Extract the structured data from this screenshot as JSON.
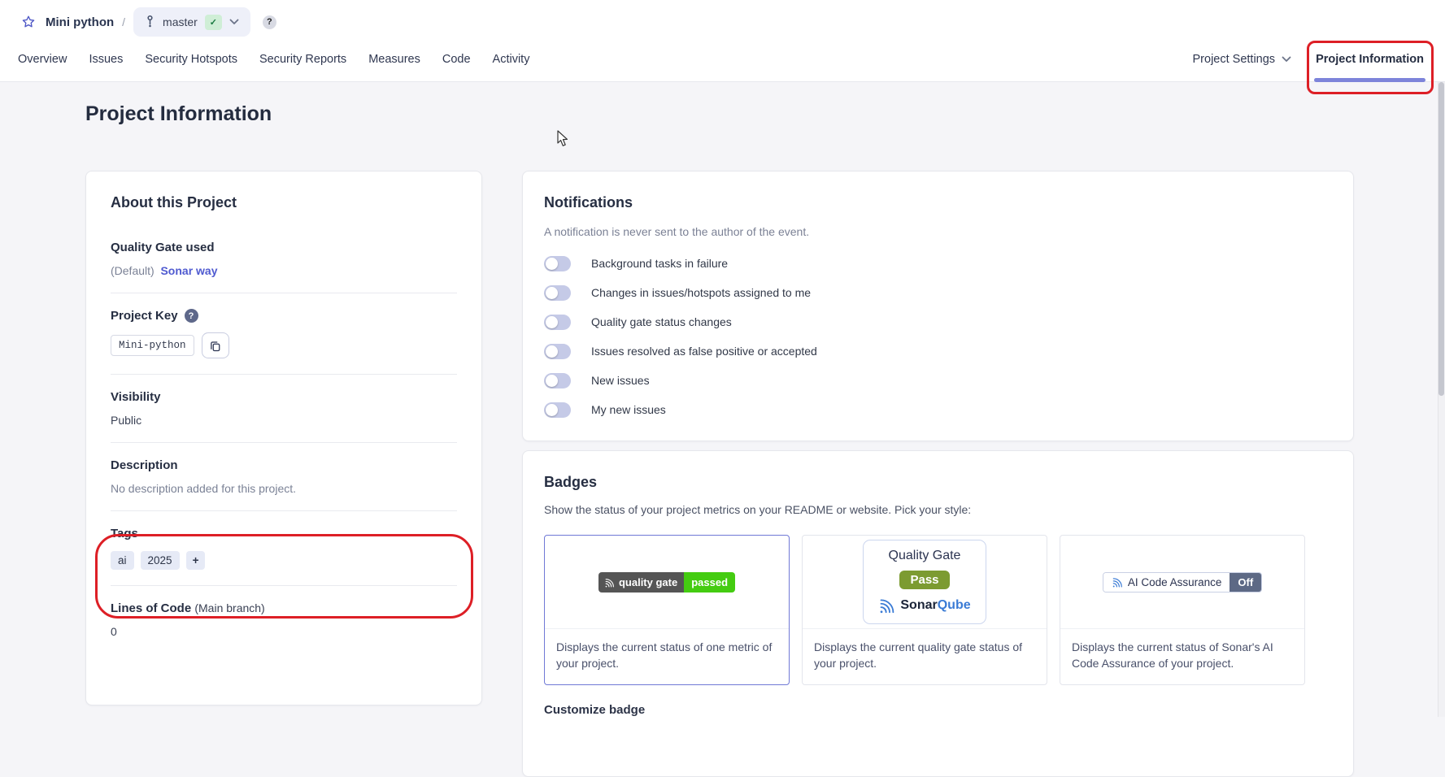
{
  "colors": {
    "accent_indigo": "#7d84da",
    "annotation_red": "#dd1f26",
    "link_blue": "#4f5ad0",
    "shield_gray": "#555555",
    "shield_green": "#44cc11",
    "pass_green": "#7c9b31",
    "off_slate": "#5d6985",
    "toggle_off": "#c5cae7"
  },
  "header": {
    "project_name": "Mini python",
    "separator": "/",
    "branch": {
      "name": "master",
      "status_icon": "✓"
    },
    "help_icon": "?"
  },
  "nav": {
    "tabs": [
      "Overview",
      "Issues",
      "Security Hotspots",
      "Security Reports",
      "Measures",
      "Code",
      "Activity"
    ],
    "project_settings": "Project Settings",
    "project_information": "Project Information"
  },
  "page": {
    "title": "Project Information"
  },
  "about": {
    "title": "About this Project",
    "quality_gate": {
      "label": "Quality Gate used",
      "prefix": "(Default)",
      "link": "Sonar way"
    },
    "project_key": {
      "label": "Project Key",
      "help_icon": "?",
      "value": "Mini-python"
    },
    "visibility": {
      "label": "Visibility",
      "value": "Public"
    },
    "description": {
      "label": "Description",
      "value": "No description added for this project."
    },
    "tags": {
      "label": "Tags",
      "items": [
        "ai",
        "2025"
      ],
      "add_label": "+"
    },
    "lines_of_code": {
      "label": "Lines of Code",
      "qualifier": "(Main branch)",
      "value": "0"
    }
  },
  "notifications": {
    "title": "Notifications",
    "note": "A notification is never sent to the author of the event.",
    "items": [
      {
        "label": "Background tasks in failure",
        "enabled": false
      },
      {
        "label": "Changes in issues/hotspots assigned to me",
        "enabled": false
      },
      {
        "label": "Quality gate status changes",
        "enabled": false
      },
      {
        "label": "Issues resolved as false positive or accepted",
        "enabled": false
      },
      {
        "label": "New issues",
        "enabled": false
      },
      {
        "label": "My new issues",
        "enabled": false
      }
    ]
  },
  "badges": {
    "title": "Badges",
    "intro": "Show the status of your project metrics on your README or website. Pick your style:",
    "options": [
      {
        "badge_left": "quality gate",
        "badge_right": "passed",
        "description": "Displays the current status of one metric of your project.",
        "selected": true
      },
      {
        "card_title": "Quality Gate",
        "status": "Pass",
        "brand_sonar": "Sonar",
        "brand_qube": "Qube",
        "description": "Displays the current quality gate status of your project.",
        "selected": false
      },
      {
        "badge_left": "AI Code Assurance",
        "badge_right": "Off",
        "description": "Displays the current status of Sonar's AI Code Assurance of your project.",
        "selected": false
      }
    ],
    "customize_label": "Customize badge"
  }
}
